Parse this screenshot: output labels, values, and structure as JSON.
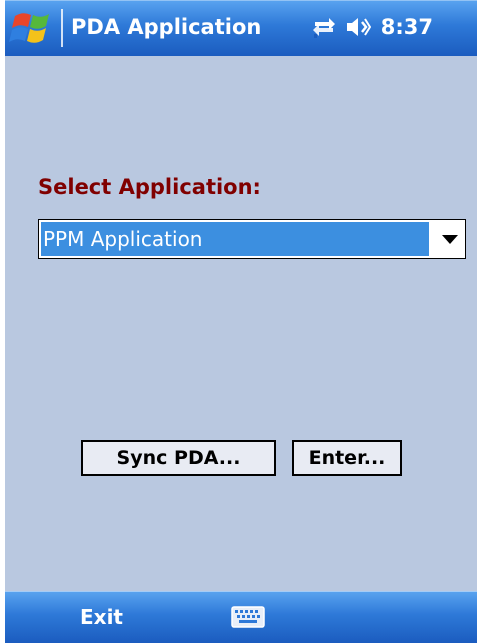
{
  "titlebar": {
    "title": "PDA Application",
    "clock": "8:37",
    "icons": [
      "windows-start-icon",
      "connectivity-icon",
      "volume-icon"
    ]
  },
  "form": {
    "label": "Select Application:",
    "combo_selected": "PPM Application",
    "sync_button": "Sync PDA...",
    "enter_button": "Enter..."
  },
  "menubar": {
    "left_softkey": "Exit",
    "sip_icon": "keyboard-icon"
  },
  "colors": {
    "titlebar_blue": "#2e79d8",
    "content_bg": "#b9c8e0",
    "label_maroon": "#800000",
    "selection_blue": "#3c8fe0"
  }
}
